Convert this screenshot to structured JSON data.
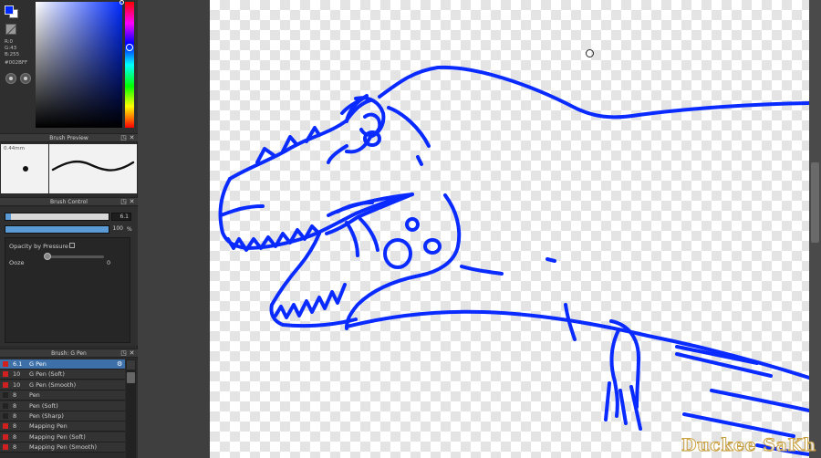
{
  "color": {
    "rgb_r": "R:0",
    "rgb_g": "G:43",
    "rgb_b": "B:255",
    "hex": "#002BFF",
    "fg_color": "#002bff",
    "bg_color": "#ffffff"
  },
  "brush_preview": {
    "title": "Brush Preview",
    "size_label": "0.44mm"
  },
  "brush_control": {
    "title": "Brush Control",
    "size_value": "6.1",
    "size_fraction": 0.05,
    "opacity_value": "100",
    "opacity_unit": "%",
    "opacity_fraction": 1.0,
    "opacity_by_pressure_label": "Opacity by Pressure",
    "ooze_label": "Ooze",
    "ooze_value": "0"
  },
  "brush_list": {
    "title": "Brush: G Pen",
    "items": [
      {
        "size": "6.1",
        "name": "G Pen",
        "color": "#d02020",
        "selected": true
      },
      {
        "size": "10",
        "name": "G Pen (Soft)",
        "color": "#d02020",
        "selected": false
      },
      {
        "size": "10",
        "name": "G Pen (Smooth)",
        "color": "#d02020",
        "selected": false
      },
      {
        "size": "8",
        "name": "Pen",
        "color": "#222222",
        "selected": false
      },
      {
        "size": "8",
        "name": "Pen (Soft)",
        "color": "#222222",
        "selected": false
      },
      {
        "size": "8",
        "name": "Pen (Sharp)",
        "color": "#222222",
        "selected": false
      },
      {
        "size": "8",
        "name": "Mapping Pen",
        "color": "#d02020",
        "selected": false
      },
      {
        "size": "8",
        "name": "Mapping Pen (Soft)",
        "color": "#d02020",
        "selected": false
      },
      {
        "size": "8",
        "name": "Mapping Pen (Smooth)",
        "color": "#d02020",
        "selected": false
      }
    ]
  },
  "canvas": {
    "stroke_color": "#0a2bff",
    "watermark": "Duckee SaKh"
  }
}
